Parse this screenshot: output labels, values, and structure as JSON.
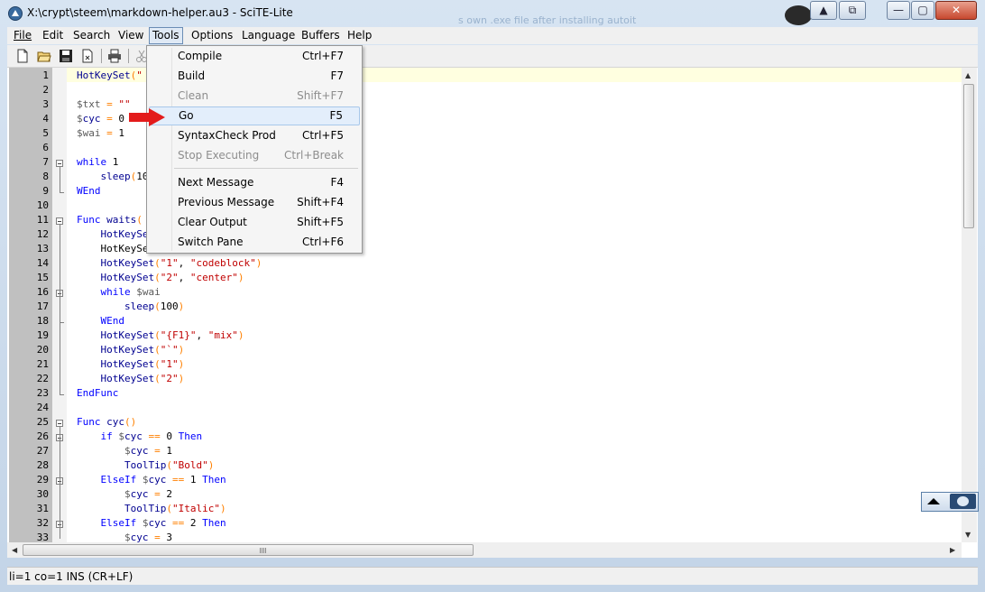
{
  "window": {
    "title": "X:\\crypt\\steem\\markdown-helper.au3 - SciTE-Lite",
    "background_text": "s own .exe file after installing autoit",
    "controls": {
      "minimize": "—",
      "maximize": "▢",
      "close": "✕"
    },
    "extra_controls": {
      "up": "▲",
      "restore": "⧉"
    }
  },
  "menubar": {
    "items": [
      {
        "label": "File"
      },
      {
        "label": "Edit"
      },
      {
        "label": "Search"
      },
      {
        "label": "View"
      },
      {
        "label": "Tools"
      },
      {
        "label": "Options"
      },
      {
        "label": "Language"
      },
      {
        "label": "Buffers"
      },
      {
        "label": "Help"
      }
    ]
  },
  "toolbar": {
    "icons": [
      "new-file-icon",
      "open-folder-icon",
      "save-icon",
      "close-file-icon",
      "print-icon",
      "cut-icon"
    ]
  },
  "tools_menu": {
    "items": [
      {
        "label": "Compile",
        "shortcut": "Ctrl+F7",
        "enabled": true
      },
      {
        "label": "Build",
        "shortcut": "F7",
        "enabled": true
      },
      {
        "label": "Clean",
        "shortcut": "Shift+F7",
        "enabled": false
      },
      {
        "label": "Go",
        "shortcut": "F5",
        "enabled": true,
        "highlighted": true
      },
      {
        "label": "SyntaxCheck Prod",
        "shortcut": "Ctrl+F5",
        "enabled": true
      },
      {
        "label": "Stop Executing",
        "shortcut": "Ctrl+Break",
        "enabled": false
      },
      {
        "label": "Next Message",
        "shortcut": "F4",
        "enabled": true
      },
      {
        "label": "Previous Message",
        "shortcut": "Shift+F4",
        "enabled": true
      },
      {
        "label": "Clear Output",
        "shortcut": "Shift+F5",
        "enabled": true
      },
      {
        "label": "Switch Pane",
        "shortcut": "Ctrl+F6",
        "enabled": true
      }
    ]
  },
  "editor": {
    "line_numbers": [
      "1",
      "2",
      "3",
      "4",
      "5",
      "6",
      "7",
      "8",
      "9",
      "10",
      "11",
      "12",
      "13",
      "14",
      "15",
      "16",
      "17",
      "18",
      "19",
      "20",
      "21",
      "22",
      "23",
      "24",
      "25",
      "26",
      "27",
      "28",
      "29",
      "30",
      "31",
      "32",
      "33"
    ],
    "lines": [
      "HotKeySet(\"",
      "",
      "$txt = \"\"",
      "$cyc = 0",
      "$wai = 1",
      "",
      "while 1",
      "    sleep(10",
      "WEnd",
      "",
      "Func waits(",
      "    HotKeySet",
      "    HotKeySe",
      "    HotKeySet(\"1\", \"codeblock\")",
      "    HotKeySet(\"2\", \"center\")",
      "    while $wai",
      "        sleep(100)",
      "    WEnd",
      "    HotKeySet(\"{F1}\", \"mix\")",
      "    HotKeySet(\"`\")",
      "    HotKeySet(\"1\")",
      "    HotKeySet(\"2\")",
      "EndFunc",
      "",
      "Func cyc()",
      "    if $cyc == 0 Then",
      "        $cyc = 1",
      "        ToolTip(\"Bold\")",
      "    ElseIf $cyc == 1 Then",
      "        $cyc = 2",
      "        ToolTip(\"Italic\")",
      "    ElseIf $cyc == 2 Then",
      "        $cyc = 3"
    ]
  },
  "statusbar": {
    "text": "li=1 co=1 INS (CR+LF)"
  },
  "colors": {
    "keyword": "#0000ff",
    "string": "#c00000",
    "operator": "#ff8000",
    "gutter": "#c0c0c0",
    "caret_line": "#ffffe0",
    "arrow": "#e31b1b"
  }
}
